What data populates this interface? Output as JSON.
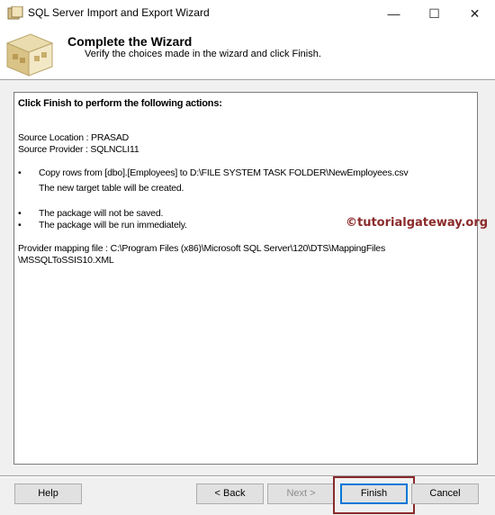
{
  "window": {
    "title": "SQL Server Import and Export Wizard",
    "minimize_glyph": "—",
    "maximize_glyph": "☐",
    "close_glyph": "✕"
  },
  "header": {
    "title": "Complete the Wizard",
    "subtitle": "Verify the choices made in the wizard and click Finish."
  },
  "summary": {
    "heading": "Click Finish to perform the following actions:",
    "source_location": "Source Location : PRASAD",
    "source_provider": "Source Provider : SQLNCLI11",
    "bullet_glyph": "•",
    "copy_action": "Copy rows from [dbo].[Employees] to D:\\FILE SYSTEM TASK FOLDER\\NewEmployees.csv",
    "copy_note": "The new target table will be created.",
    "package_saved": "The package will not be saved.",
    "package_run": "The package will be run immediately.",
    "mapping_file_line1": "Provider mapping file : C:\\Program Files (x86)\\Microsoft SQL Server\\120\\DTS\\MappingFiles",
    "mapping_file_line2": "\\MSSQLToSSIS10.XML"
  },
  "watermark": "©tutorialgateway.org",
  "buttons": {
    "help": "Help",
    "back": "< Back",
    "next": "Next >",
    "finish": "Finish",
    "cancel": "Cancel"
  }
}
